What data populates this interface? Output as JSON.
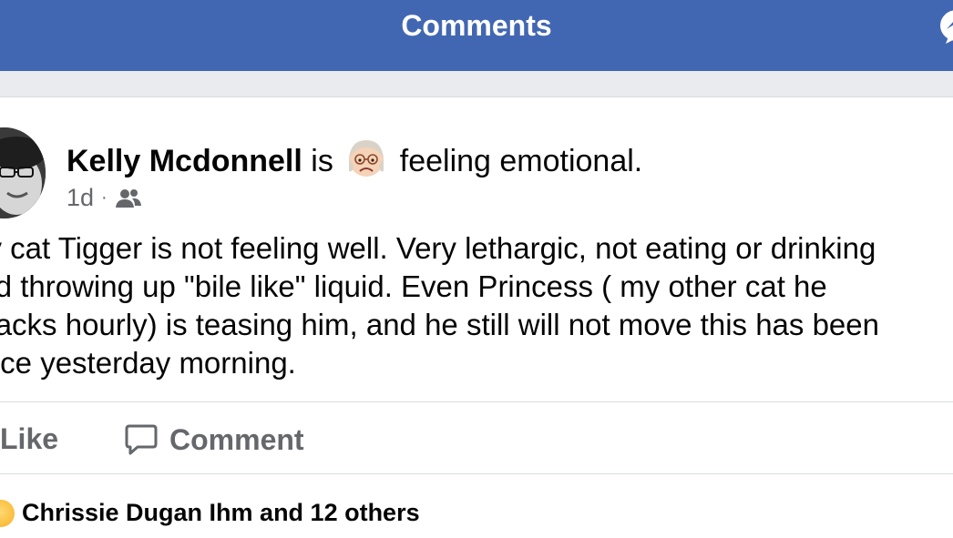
{
  "header": {
    "title": "Comments",
    "messenger_icon": "messenger-icon"
  },
  "post": {
    "author": "Kelly Mcdonnell",
    "is": "is",
    "feeling": "feeling emotional.",
    "feeling_icon": "crying-face-emoji",
    "time": "1d",
    "separator": "·",
    "audience_icon": "friends-icon",
    "body_lines": [
      "My cat Tigger is not feeling well.  Very lethargic, not eating or drinking",
      "and  throwing up \"bile like\" liquid.  Even Princess ( my other cat he",
      "attacks hourly) is teasing him, and he still will not move this has been",
      "since yesterday morning."
    ]
  },
  "actions": {
    "like_label": "Like",
    "comment_label": "Comment",
    "comment_icon": "comment-bubble-icon"
  },
  "reactions": {
    "summary": "Chrissie Dugan Ihm and 12 others",
    "icon": "care-reaction-icon"
  }
}
